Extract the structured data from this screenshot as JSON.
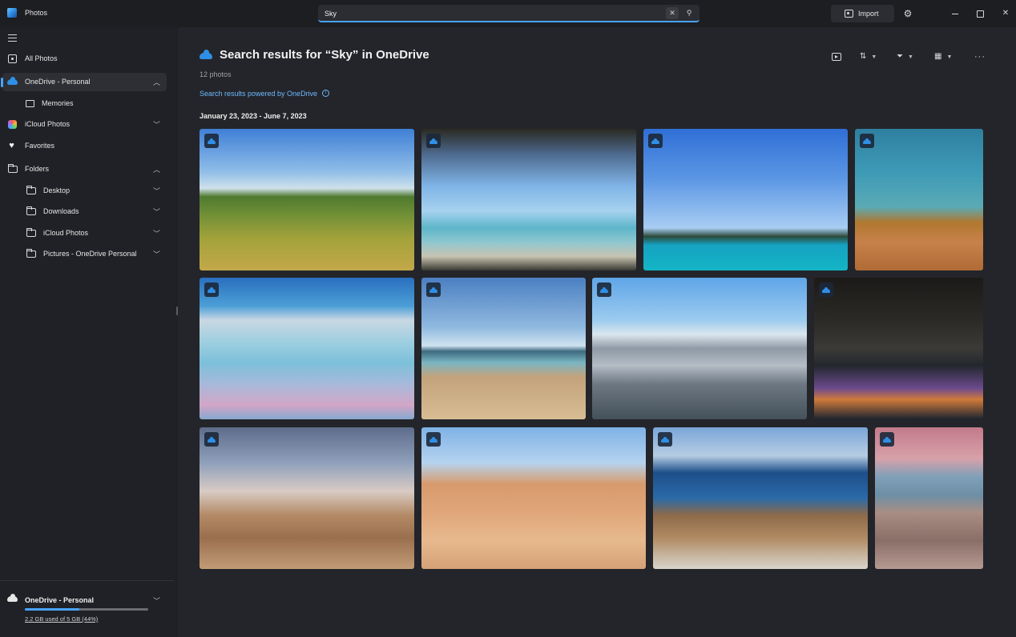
{
  "titlebar": {
    "app_title": "Photos",
    "search": {
      "value": "Sky",
      "clear_icon": "close-icon",
      "search_icon": "search-icon"
    },
    "import_label": "Import",
    "settings_icon": "gear-icon",
    "window_controls": [
      "minimize",
      "maximize",
      "close"
    ]
  },
  "sidebar": {
    "menu_icon": "hamburger-icon",
    "items": [
      {
        "label": "All Photos",
        "icon": "photos-icon"
      },
      {
        "label": "OneDrive - Personal",
        "icon": "onedrive-cloud-icon",
        "selected": true,
        "expanded": true
      },
      {
        "label": "Memories",
        "icon": "memories-icon"
      },
      {
        "label": "iCloud Photos",
        "icon": "icloud-icon",
        "expanded": false
      },
      {
        "label": "Favorites",
        "icon": "heart-icon"
      },
      {
        "label": "Folders",
        "icon": "folder-icon",
        "expanded": true
      },
      {
        "label": "Desktop",
        "icon": "folder-icon",
        "expanded": false
      },
      {
        "label": "Downloads",
        "icon": "folder-icon",
        "expanded": false
      },
      {
        "label": "iCloud Photos",
        "icon": "folder-icon",
        "expanded": false
      },
      {
        "label": "Pictures - OneDrive Personal",
        "icon": "folder-icon",
        "expanded": false
      }
    ],
    "storage": {
      "title": "OneDrive - Personal",
      "usage_text": "2.2 GB used of 5 GB (44%)",
      "used_fraction": 0.44
    }
  },
  "main": {
    "title": "Search results for “Sky” in OneDrive",
    "photo_count": "12 photos",
    "powered_by": "Search results powered by OneDrive",
    "date_range": "January 23, 2023 - June 7, 2023",
    "toolbar": {
      "slideshow_icon": "slideshow-icon",
      "sort_icon": "sort-icon",
      "filter_icon": "filter-icon",
      "view_icon": "view-options-icon",
      "more_icon": "more-icon"
    },
    "photos": [
      {
        "subject": "green hills under blue sky",
        "source": "onedrive"
      },
      {
        "subject": "beach umbrellas and palm trees",
        "source": "onedrive"
      },
      {
        "subject": "blue sea and island horizon",
        "source": "onedrive"
      },
      {
        "subject": "desert and teal sky",
        "source": "onedrive"
      },
      {
        "subject": "view from airplane wing",
        "source": "onedrive"
      },
      {
        "subject": "sandy beach with tree",
        "source": "onedrive"
      },
      {
        "subject": "city skyline with mountains",
        "source": "onedrive"
      },
      {
        "subject": "city skyline at night",
        "source": "onedrive"
      },
      {
        "subject": "desert with joshua trees",
        "source": "onedrive"
      },
      {
        "subject": "hiker on sandstone rocks",
        "source": "onedrive"
      },
      {
        "subject": "rocky coastline and ocean",
        "source": "onedrive"
      },
      {
        "subject": "person on rocky shore at sunset",
        "source": "onedrive"
      }
    ]
  }
}
